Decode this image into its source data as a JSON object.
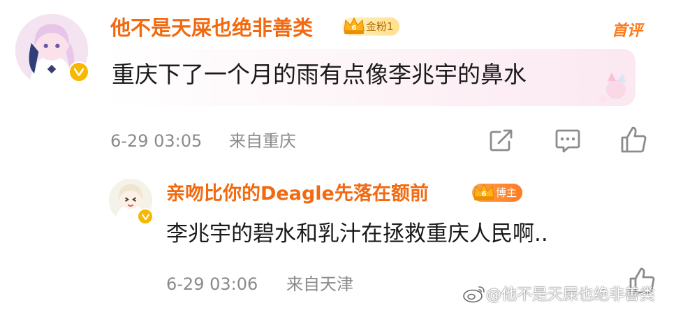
{
  "comment": {
    "username": "他不是天屎也绝非善类",
    "fan_badge": "金粉1",
    "first_tag": "首评",
    "text": "重庆下了一个月的雨有点像李兆宇的鼻水",
    "time": "6-29 03:05",
    "location": "来自重庆"
  },
  "reply": {
    "username": "亲吻比你的Deagle先落在额前",
    "role_badge": "博主",
    "text": "李兆宇的碧水和乳汁在拯救重庆人民啊..",
    "time": "6-29 03:06",
    "location": "来自天津"
  },
  "watermark": "@他不是天屎也绝非善类",
  "icons": {
    "share": "share-icon",
    "comment": "comment-icon",
    "like": "like-icon",
    "verified": "verified-badge-icon",
    "crown": "crown-icon",
    "weibo": "weibo-logo-icon"
  },
  "colors": {
    "username": "#f2690f",
    "verified": "#f6b800",
    "meta": "#8a8a8a",
    "icon": "#8c8c8c"
  }
}
